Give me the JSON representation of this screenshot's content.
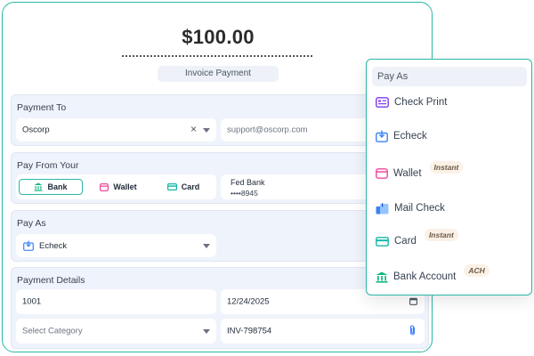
{
  "amount": "$100.00",
  "caption": "Invoice Payment",
  "payment_to": {
    "title": "Payment To",
    "payee": "Oscorp",
    "clear_symbol": "×",
    "email_placeholder": "support@oscorp.com"
  },
  "pay_from": {
    "title": "Pay From Your",
    "options": [
      {
        "label": "Bank",
        "icon": "bank-icon",
        "active": true
      },
      {
        "label": "Wallet",
        "icon": "wallet-icon",
        "active": false
      },
      {
        "label": "Card",
        "icon": "card-icon",
        "active": false
      }
    ],
    "account_name": "Fed Bank",
    "account_number": "••••8945"
  },
  "pay_as": {
    "title": "Pay As",
    "selected": "Echeck"
  },
  "payment_details": {
    "title": "Payment Details",
    "number": "1001",
    "date": "12/24/2025",
    "category_placeholder": "Select Category",
    "invoice": "INV-798754"
  },
  "popup": {
    "title": "Pay As",
    "items": [
      {
        "label": "Check Print",
        "icon": "check-print-icon",
        "badge": ""
      },
      {
        "label": "Echeck",
        "icon": "echeck-icon",
        "badge": ""
      },
      {
        "label": "Wallet",
        "icon": "wallet-icon",
        "badge": "Instant"
      },
      {
        "label": "Mail Check",
        "icon": "mail-check-icon",
        "badge": ""
      },
      {
        "label": "Card",
        "icon": "card-icon",
        "badge": "Instant"
      },
      {
        "label": "Bank Account",
        "icon": "bank-icon",
        "badge": "ACH"
      }
    ]
  },
  "colors": {
    "accent": "#2bb7a8",
    "section_bg": "#eff3fb",
    "check_print": "#7c3aed",
    "echeck": "#3b82f6",
    "wallet": "#ec4899",
    "mail_check": "#3b82f6",
    "card": "#14b8a6",
    "bank": "#10b981",
    "badge_bg": "#fbf1e6"
  }
}
